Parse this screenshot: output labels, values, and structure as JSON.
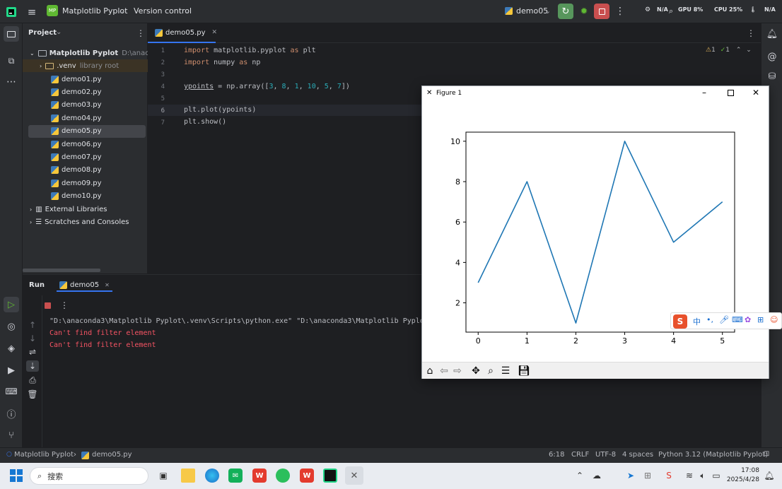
{
  "titlebar": {
    "project_name": "Matplotlib Pyplot",
    "project_badge": "MP",
    "vcs_label": "Version control",
    "run_config": "demo05",
    "monitor": {
      "net": "N/A",
      "gpu": "GPU 8%",
      "cpu": "CPU 25%",
      "cpu_label": "CPU",
      "cpu_pct": "25%",
      "gpu_pct": "8%",
      "temp": "N/A"
    }
  },
  "project": {
    "header": "Project",
    "root": "Matplotlib Pyplot",
    "root_path": "D:\\anacond",
    "venv": ".venv",
    "venv_hint": "library root",
    "files": [
      "demo01.py",
      "demo02.py",
      "demo03.py",
      "demo04.py",
      "demo05.py",
      "demo06.py",
      "demo07.py",
      "demo08.py",
      "demo09.py",
      "demo10.py"
    ],
    "external_libs": "External Libraries",
    "scratches": "Scratches and Consoles"
  },
  "editor": {
    "tab": "demo05.py",
    "line_numbers": [
      "1",
      "2",
      "3",
      "4",
      "5",
      "6",
      "7"
    ],
    "lines": {
      "l1_kw1": "import",
      "l1_mod": " matplotlib.pyplot ",
      "l1_kw2": "as",
      "l1_alias": " plt",
      "l2_kw1": "import",
      "l2_mod": " numpy ",
      "l2_kw2": "as",
      "l2_alias": " np",
      "l4_var": "ypoints",
      "l4_pre": " = np.array([",
      "l4_n1": "3",
      "l4_n2": "8",
      "l4_n3": "1",
      "l4_n4": "10",
      "l4_n5": "5",
      "l4_n6": "7",
      "l4_sep": ", ",
      "l4_end": "])",
      "l6": "plt.plot(ypoints)",
      "l7": "plt.show()"
    },
    "inspections": {
      "warnings": "1",
      "checks": "1"
    }
  },
  "run": {
    "tab_run": "Run",
    "tab_config": "demo05",
    "cmd": "\"D:\\anaconda3\\Matplotlib Pyplot\\.venv\\Scripts\\python.exe\" \"D:\\anaconda3\\Matplotlib Pyplot\\",
    "err1": "Can't find filter element",
    "err2": "Can't find filter element"
  },
  "figure": {
    "title": "Figure 1"
  },
  "chart_data": {
    "type": "line",
    "x": [
      0,
      1,
      2,
      3,
      4,
      5
    ],
    "series": [
      {
        "values": [
          3,
          8,
          1,
          10,
          5,
          7
        ],
        "color": "#1f77b4"
      }
    ],
    "xticks": [
      "0",
      "1",
      "2",
      "3",
      "4",
      "5"
    ],
    "yticks": [
      "2",
      "4",
      "6",
      "8",
      "10"
    ],
    "xlim": [
      -0.25,
      5.25
    ],
    "ylim": [
      0.55,
      10.45
    ],
    "grid": false,
    "title": "",
    "xlabel": "",
    "ylabel": ""
  },
  "statusbar": {
    "project": "Matplotlib Pyplot",
    "file": "demo05.py",
    "pos": "6:18",
    "eol": "CRLF",
    "enc": "UTF-8",
    "indent": "4 spaces",
    "interpreter": "Python 3.12 (Matplotlib Pyplot)"
  },
  "taskbar": {
    "search": "搜索",
    "time": "17:08",
    "date": "2025/4/28"
  },
  "ime": {
    "lang": "中"
  }
}
